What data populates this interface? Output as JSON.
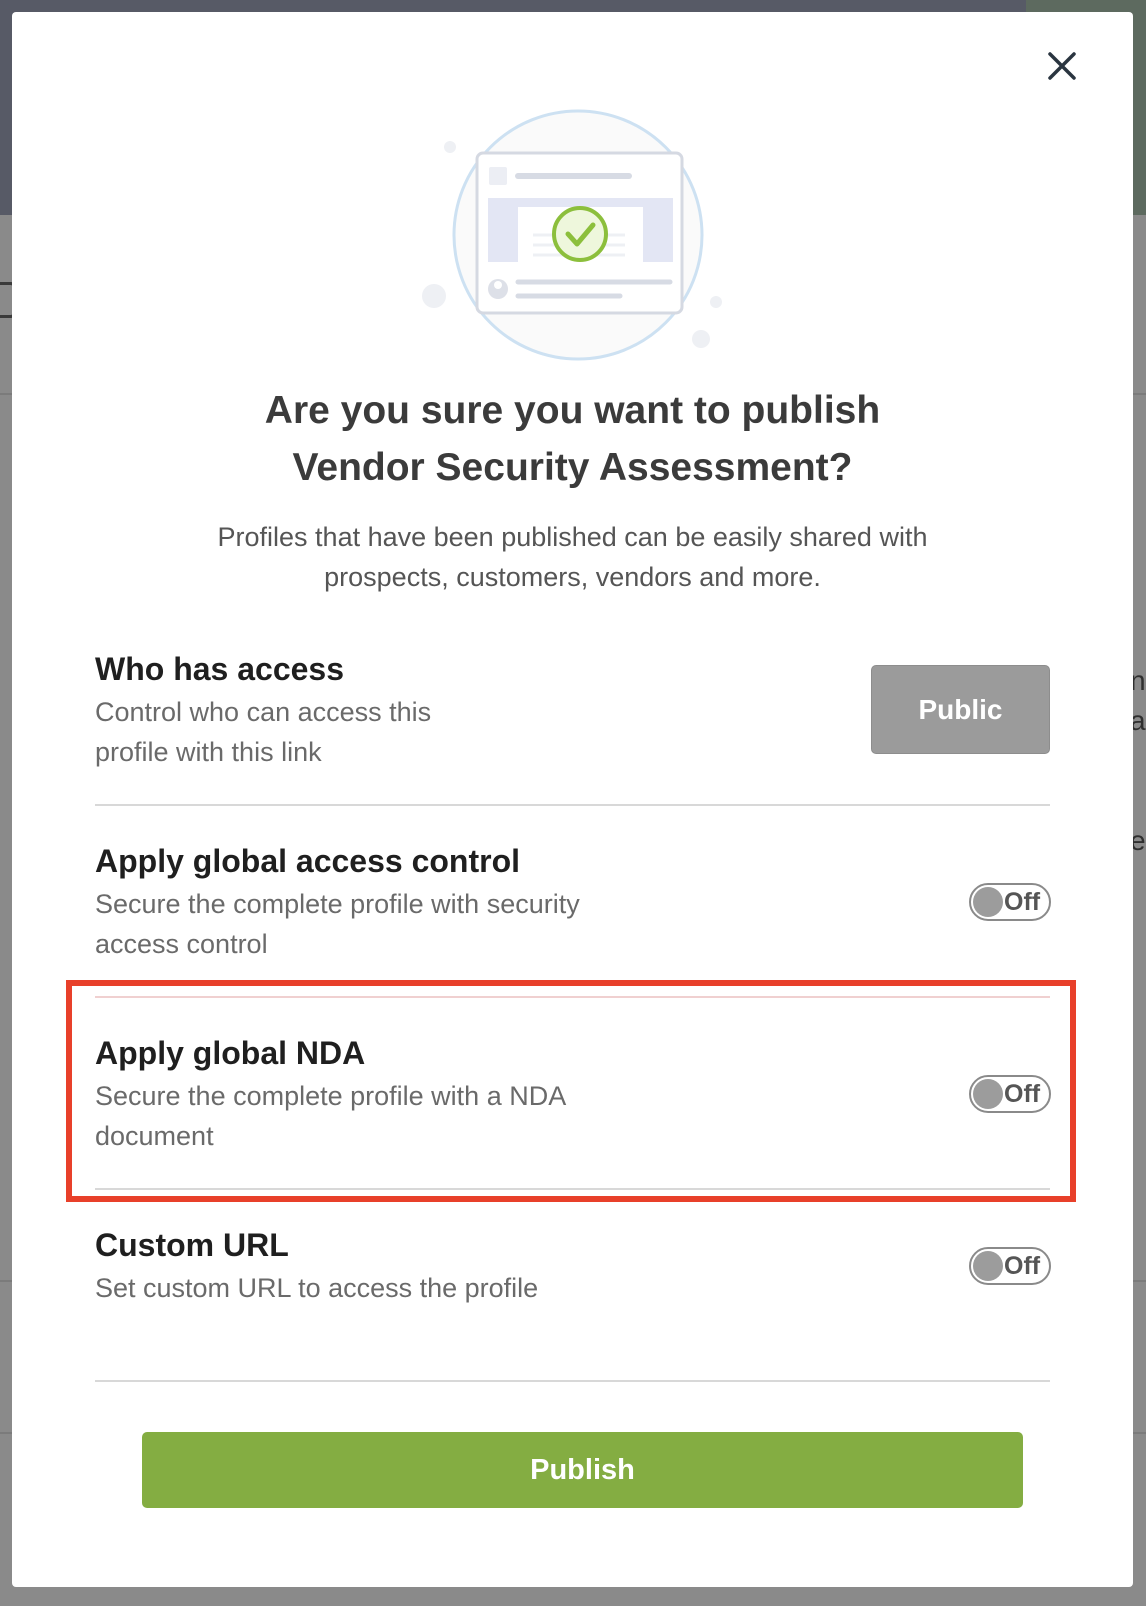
{
  "modal": {
    "title_line1": "Are you sure you want to publish",
    "title_line2": "Vendor Security Assessment?",
    "subtitle_line1": "Profiles that have been published can be easily shared with",
    "subtitle_line2": "prospects, customers, vendors and more.",
    "close_icon": "close-icon"
  },
  "access": {
    "title": "Who has access",
    "desc_line1": "Control who can access this",
    "desc_line2": "profile with this link",
    "button_label": "Public"
  },
  "options": [
    {
      "title": "Apply global access control",
      "desc_line1": "Secure the complete profile with security",
      "desc_line2": "access control",
      "toggle_label": "Off"
    },
    {
      "title": "Apply global NDA",
      "desc_line1": "Secure the complete profile with a NDA",
      "desc_line2": "document",
      "toggle_label": "Off"
    },
    {
      "title": "Custom URL",
      "desc_line1": "Set custom URL to access the profile",
      "toggle_label": "Off"
    }
  ],
  "publish": {
    "label": "Publish"
  },
  "colors": {
    "publish": "#84ad42",
    "public_button": "#9b9b9b",
    "highlight": "#e8402a"
  }
}
